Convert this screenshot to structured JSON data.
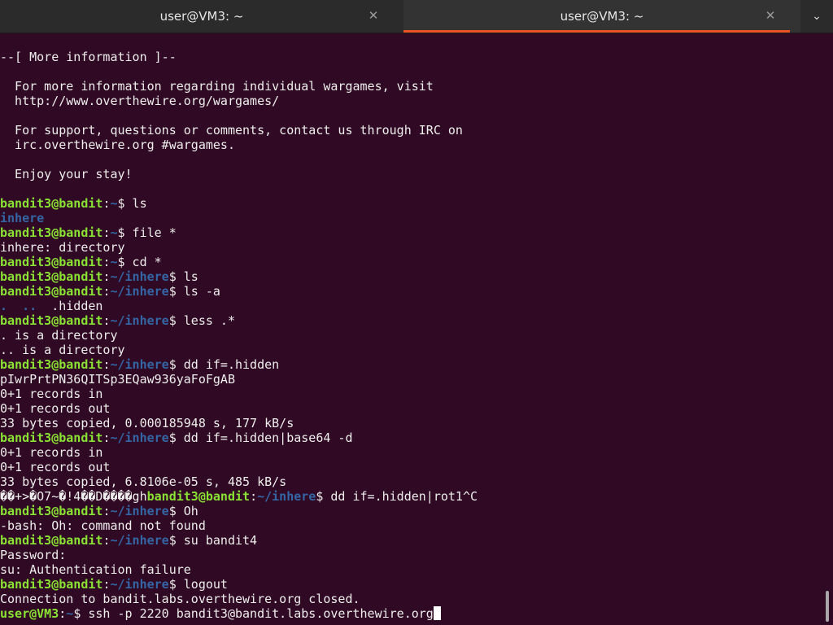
{
  "tabs": [
    {
      "title": "user@VM3: ~",
      "close": "✕"
    },
    {
      "title": "user@VM3: ~",
      "close": "✕"
    }
  ],
  "menu_icon": "⌄",
  "terminal": {
    "lines": [
      [
        {
          "t": "--[ More information ]--",
          "c": ""
        }
      ],
      [
        {
          "t": "",
          "c": ""
        }
      ],
      [
        {
          "t": "  For more information regarding individual wargames, visit",
          "c": ""
        }
      ],
      [
        {
          "t": "  http://www.overthewire.org/wargames/",
          "c": ""
        }
      ],
      [
        {
          "t": "",
          "c": ""
        }
      ],
      [
        {
          "t": "  For support, questions or comments, contact us through IRC on",
          "c": ""
        }
      ],
      [
        {
          "t": "  irc.overthewire.org #wargames.",
          "c": ""
        }
      ],
      [
        {
          "t": "",
          "c": ""
        }
      ],
      [
        {
          "t": "  Enjoy your stay!",
          "c": ""
        }
      ],
      [
        {
          "t": "",
          "c": ""
        }
      ],
      [
        {
          "t": "bandit3@bandit",
          "c": "pg"
        },
        {
          "t": ":",
          "c": ""
        },
        {
          "t": "~",
          "c": "pb"
        },
        {
          "t": "$ ls",
          "c": ""
        }
      ],
      [
        {
          "t": "inhere",
          "c": "dirc"
        }
      ],
      [
        {
          "t": "bandit3@bandit",
          "c": "pg"
        },
        {
          "t": ":",
          "c": ""
        },
        {
          "t": "~",
          "c": "pb"
        },
        {
          "t": "$ file *",
          "c": ""
        }
      ],
      [
        {
          "t": "inhere: directory",
          "c": ""
        }
      ],
      [
        {
          "t": "bandit3@bandit",
          "c": "pg"
        },
        {
          "t": ":",
          "c": ""
        },
        {
          "t": "~",
          "c": "pb"
        },
        {
          "t": "$ cd *",
          "c": ""
        }
      ],
      [
        {
          "t": "bandit3@bandit",
          "c": "pg"
        },
        {
          "t": ":",
          "c": ""
        },
        {
          "t": "~/inhere",
          "c": "pb"
        },
        {
          "t": "$ ls",
          "c": ""
        }
      ],
      [
        {
          "t": "bandit3@bandit",
          "c": "pg"
        },
        {
          "t": ":",
          "c": ""
        },
        {
          "t": "~/inhere",
          "c": "pb"
        },
        {
          "t": "$ ls -a",
          "c": ""
        }
      ],
      [
        {
          "t": ".",
          "c": "dirc"
        },
        {
          "t": "  ",
          "c": ""
        },
        {
          "t": "..",
          "c": "dirc"
        },
        {
          "t": "  .hidden",
          "c": ""
        }
      ],
      [
        {
          "t": "bandit3@bandit",
          "c": "pg"
        },
        {
          "t": ":",
          "c": ""
        },
        {
          "t": "~/inhere",
          "c": "pb"
        },
        {
          "t": "$ less .*",
          "c": ""
        }
      ],
      [
        {
          "t": ". is a directory",
          "c": ""
        }
      ],
      [
        {
          "t": ".. is a directory",
          "c": ""
        }
      ],
      [
        {
          "t": "bandit3@bandit",
          "c": "pg"
        },
        {
          "t": ":",
          "c": ""
        },
        {
          "t": "~/inhere",
          "c": "pb"
        },
        {
          "t": "$ dd if=.hidden",
          "c": ""
        }
      ],
      [
        {
          "t": "pIwrPrtPN36QITSp3EQaw936yaFoFgAB",
          "c": ""
        }
      ],
      [
        {
          "t": "0+1 records in",
          "c": ""
        }
      ],
      [
        {
          "t": "0+1 records out",
          "c": ""
        }
      ],
      [
        {
          "t": "33 bytes copied, 0.000185948 s, 177 kB/s",
          "c": ""
        }
      ],
      [
        {
          "t": "bandit3@bandit",
          "c": "pg"
        },
        {
          "t": ":",
          "c": ""
        },
        {
          "t": "~/inhere",
          "c": "pb"
        },
        {
          "t": "$ dd if=.hidden|base64 -d",
          "c": ""
        }
      ],
      [
        {
          "t": "0+1 records in",
          "c": ""
        }
      ],
      [
        {
          "t": "0+1 records out",
          "c": ""
        }
      ],
      [
        {
          "t": "33 bytes copied, 6.8106e-05 s, 485 kB/s",
          "c": ""
        }
      ],
      [
        {
          "t": "��+>�O7~�!4��D����gh",
          "c": ""
        },
        {
          "t": "bandit3@bandit",
          "c": "pg"
        },
        {
          "t": ":",
          "c": ""
        },
        {
          "t": "~/inhere",
          "c": "pb"
        },
        {
          "t": "$ dd if=.hidden|rot1^C",
          "c": ""
        }
      ],
      [
        {
          "t": "bandit3@bandit",
          "c": "pg"
        },
        {
          "t": ":",
          "c": ""
        },
        {
          "t": "~/inhere",
          "c": "pb"
        },
        {
          "t": "$ Oh",
          "c": ""
        }
      ],
      [
        {
          "t": "-bash: Oh: command not found",
          "c": ""
        }
      ],
      [
        {
          "t": "bandit3@bandit",
          "c": "pg"
        },
        {
          "t": ":",
          "c": ""
        },
        {
          "t": "~/inhere",
          "c": "pb"
        },
        {
          "t": "$ su bandit4",
          "c": ""
        }
      ],
      [
        {
          "t": "Password:",
          "c": ""
        }
      ],
      [
        {
          "t": "su: Authentication failure",
          "c": ""
        }
      ],
      [
        {
          "t": "bandit3@bandit",
          "c": "pg"
        },
        {
          "t": ":",
          "c": ""
        },
        {
          "t": "~/inhere",
          "c": "pb"
        },
        {
          "t": "$ logout",
          "c": ""
        }
      ],
      [
        {
          "t": "Connection to bandit.labs.overthewire.org closed.",
          "c": ""
        }
      ],
      [
        {
          "t": "user@VM3",
          "c": "pg"
        },
        {
          "t": ":",
          "c": ""
        },
        {
          "t": "~",
          "c": "pb"
        },
        {
          "t": "$ ssh -p 2220 bandit3@bandit.labs.overthewire.org",
          "c": ""
        }
      ]
    ]
  },
  "colors": {
    "background": "#300a24",
    "prompt_user": "#8ae234",
    "prompt_path": "#3465a4",
    "tab_accent": "#e95420"
  }
}
